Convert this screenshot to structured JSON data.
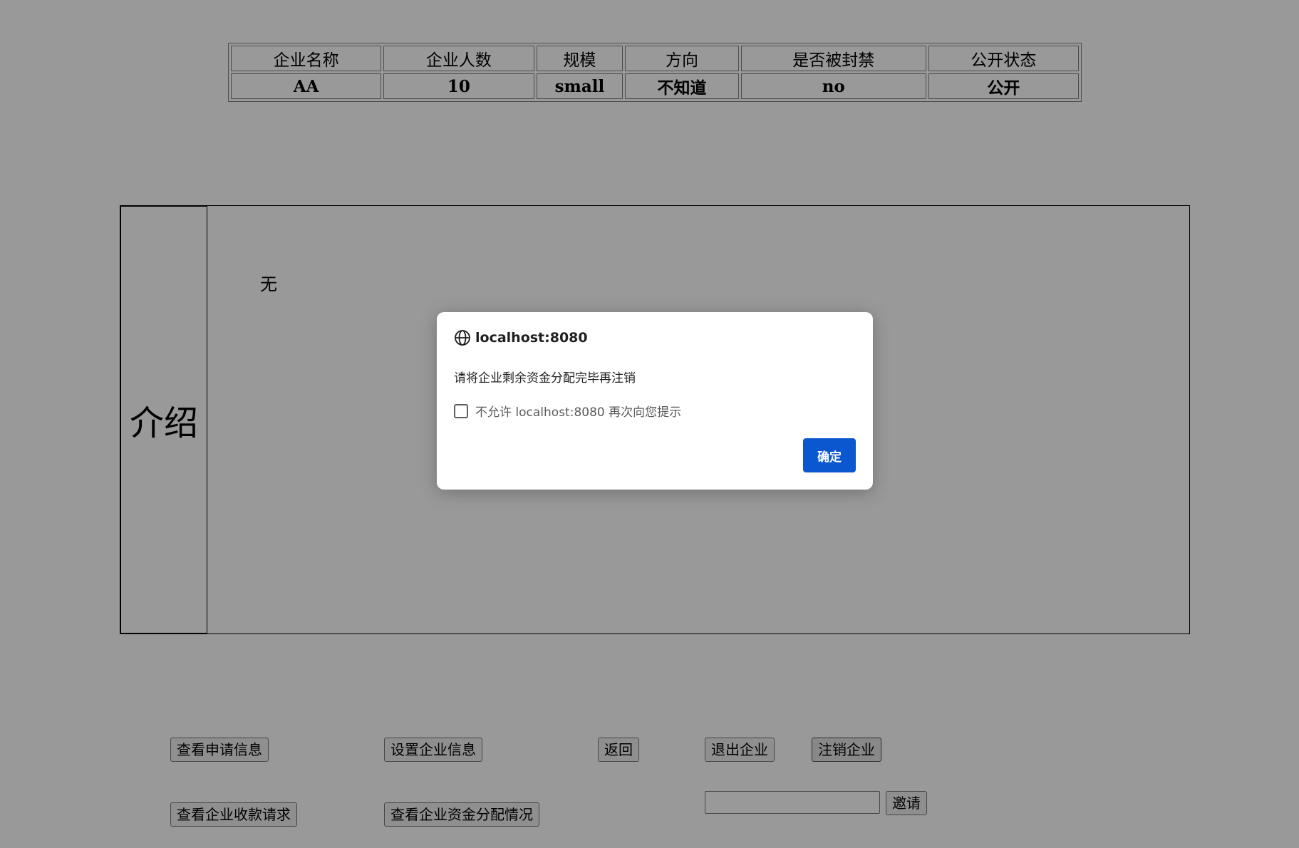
{
  "table": {
    "headers": [
      "企业名称",
      "企业人数",
      "规模",
      "方向",
      "是否被封禁",
      "公开状态"
    ],
    "row": [
      "AA",
      "10",
      "small",
      "不知道",
      "no",
      "公开"
    ]
  },
  "intro": {
    "label": "介绍",
    "text": "无"
  },
  "buttons": {
    "view_applications": "查看申请信息",
    "set_enterprise_info": "设置企业信息",
    "back": "返回",
    "leave_enterprise": "退出企业",
    "cancel_enterprise": "注销企业",
    "view_payment_requests": "查看企业收款请求",
    "view_fund_allocation": "查看企业资金分配情况",
    "invite": "邀请"
  },
  "invite_input": {
    "value": "",
    "placeholder": ""
  },
  "dialog": {
    "origin": "localhost:8080",
    "message": "请将企业剩余资金分配完毕再注销",
    "checkbox_label": "不允许 localhost:8080 再次向您提示",
    "checkbox_checked": false,
    "ok_label": "确定",
    "ok_color": "#0b57d0",
    "icon": "globe-icon"
  }
}
